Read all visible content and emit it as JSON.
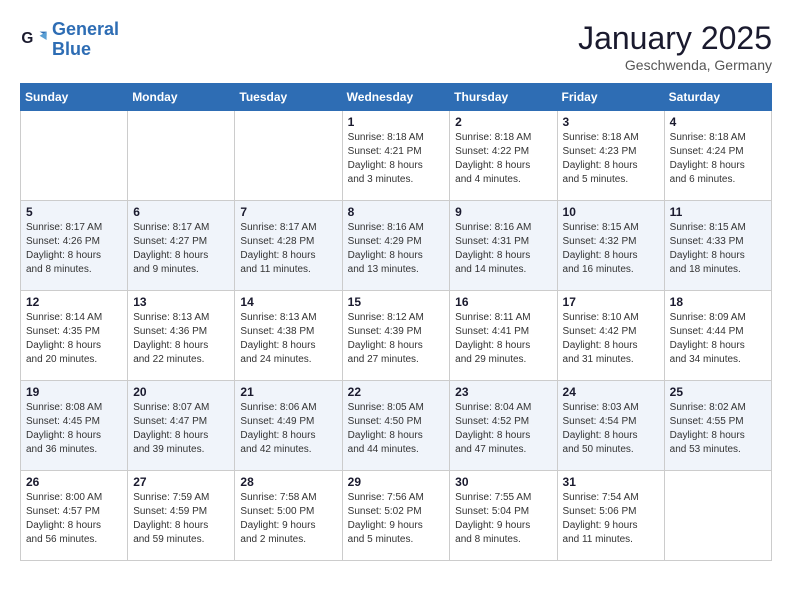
{
  "header": {
    "logo": {
      "line1": "General",
      "line2": "Blue"
    },
    "title": "January 2025",
    "subtitle": "Geschwenda, Germany"
  },
  "weekdays": [
    "Sunday",
    "Monday",
    "Tuesday",
    "Wednesday",
    "Thursday",
    "Friday",
    "Saturday"
  ],
  "weeks": [
    [
      {
        "day": "",
        "info": ""
      },
      {
        "day": "",
        "info": ""
      },
      {
        "day": "",
        "info": ""
      },
      {
        "day": "1",
        "info": "Sunrise: 8:18 AM\nSunset: 4:21 PM\nDaylight: 8 hours\nand 3 minutes."
      },
      {
        "day": "2",
        "info": "Sunrise: 8:18 AM\nSunset: 4:22 PM\nDaylight: 8 hours\nand 4 minutes."
      },
      {
        "day": "3",
        "info": "Sunrise: 8:18 AM\nSunset: 4:23 PM\nDaylight: 8 hours\nand 5 minutes."
      },
      {
        "day": "4",
        "info": "Sunrise: 8:18 AM\nSunset: 4:24 PM\nDaylight: 8 hours\nand 6 minutes."
      }
    ],
    [
      {
        "day": "5",
        "info": "Sunrise: 8:17 AM\nSunset: 4:26 PM\nDaylight: 8 hours\nand 8 minutes."
      },
      {
        "day": "6",
        "info": "Sunrise: 8:17 AM\nSunset: 4:27 PM\nDaylight: 8 hours\nand 9 minutes."
      },
      {
        "day": "7",
        "info": "Sunrise: 8:17 AM\nSunset: 4:28 PM\nDaylight: 8 hours\nand 11 minutes."
      },
      {
        "day": "8",
        "info": "Sunrise: 8:16 AM\nSunset: 4:29 PM\nDaylight: 8 hours\nand 13 minutes."
      },
      {
        "day": "9",
        "info": "Sunrise: 8:16 AM\nSunset: 4:31 PM\nDaylight: 8 hours\nand 14 minutes."
      },
      {
        "day": "10",
        "info": "Sunrise: 8:15 AM\nSunset: 4:32 PM\nDaylight: 8 hours\nand 16 minutes."
      },
      {
        "day": "11",
        "info": "Sunrise: 8:15 AM\nSunset: 4:33 PM\nDaylight: 8 hours\nand 18 minutes."
      }
    ],
    [
      {
        "day": "12",
        "info": "Sunrise: 8:14 AM\nSunset: 4:35 PM\nDaylight: 8 hours\nand 20 minutes."
      },
      {
        "day": "13",
        "info": "Sunrise: 8:13 AM\nSunset: 4:36 PM\nDaylight: 8 hours\nand 22 minutes."
      },
      {
        "day": "14",
        "info": "Sunrise: 8:13 AM\nSunset: 4:38 PM\nDaylight: 8 hours\nand 24 minutes."
      },
      {
        "day": "15",
        "info": "Sunrise: 8:12 AM\nSunset: 4:39 PM\nDaylight: 8 hours\nand 27 minutes."
      },
      {
        "day": "16",
        "info": "Sunrise: 8:11 AM\nSunset: 4:41 PM\nDaylight: 8 hours\nand 29 minutes."
      },
      {
        "day": "17",
        "info": "Sunrise: 8:10 AM\nSunset: 4:42 PM\nDaylight: 8 hours\nand 31 minutes."
      },
      {
        "day": "18",
        "info": "Sunrise: 8:09 AM\nSunset: 4:44 PM\nDaylight: 8 hours\nand 34 minutes."
      }
    ],
    [
      {
        "day": "19",
        "info": "Sunrise: 8:08 AM\nSunset: 4:45 PM\nDaylight: 8 hours\nand 36 minutes."
      },
      {
        "day": "20",
        "info": "Sunrise: 8:07 AM\nSunset: 4:47 PM\nDaylight: 8 hours\nand 39 minutes."
      },
      {
        "day": "21",
        "info": "Sunrise: 8:06 AM\nSunset: 4:49 PM\nDaylight: 8 hours\nand 42 minutes."
      },
      {
        "day": "22",
        "info": "Sunrise: 8:05 AM\nSunset: 4:50 PM\nDaylight: 8 hours\nand 44 minutes."
      },
      {
        "day": "23",
        "info": "Sunrise: 8:04 AM\nSunset: 4:52 PM\nDaylight: 8 hours\nand 47 minutes."
      },
      {
        "day": "24",
        "info": "Sunrise: 8:03 AM\nSunset: 4:54 PM\nDaylight: 8 hours\nand 50 minutes."
      },
      {
        "day": "25",
        "info": "Sunrise: 8:02 AM\nSunset: 4:55 PM\nDaylight: 8 hours\nand 53 minutes."
      }
    ],
    [
      {
        "day": "26",
        "info": "Sunrise: 8:00 AM\nSunset: 4:57 PM\nDaylight: 8 hours\nand 56 minutes."
      },
      {
        "day": "27",
        "info": "Sunrise: 7:59 AM\nSunset: 4:59 PM\nDaylight: 8 hours\nand 59 minutes."
      },
      {
        "day": "28",
        "info": "Sunrise: 7:58 AM\nSunset: 5:00 PM\nDaylight: 9 hours\nand 2 minutes."
      },
      {
        "day": "29",
        "info": "Sunrise: 7:56 AM\nSunset: 5:02 PM\nDaylight: 9 hours\nand 5 minutes."
      },
      {
        "day": "30",
        "info": "Sunrise: 7:55 AM\nSunset: 5:04 PM\nDaylight: 9 hours\nand 8 minutes."
      },
      {
        "day": "31",
        "info": "Sunrise: 7:54 AM\nSunset: 5:06 PM\nDaylight: 9 hours\nand 11 minutes."
      },
      {
        "day": "",
        "info": ""
      }
    ]
  ]
}
